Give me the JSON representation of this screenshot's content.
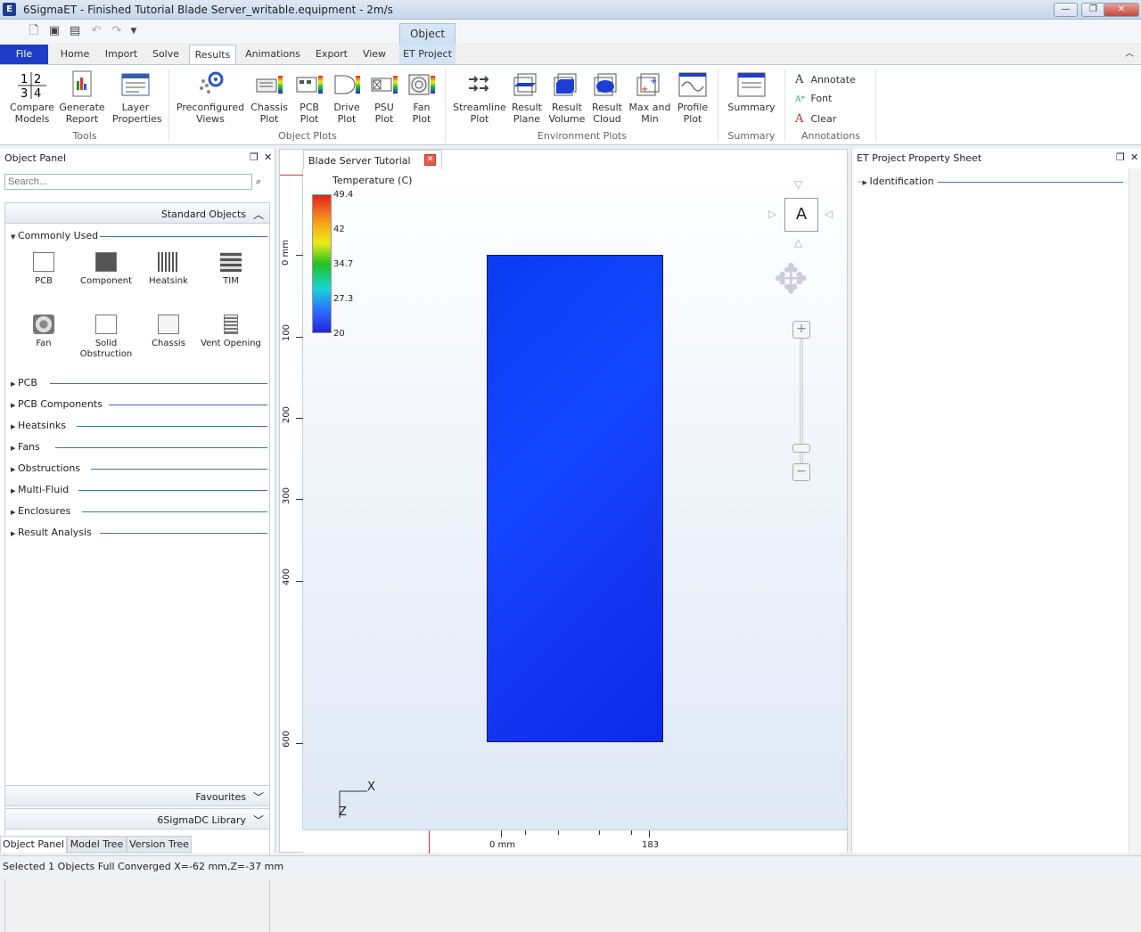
{
  "window": {
    "title": "6SigmaET - Finished Tutorial Blade Server_writable.equipment - 2m/s",
    "app_icon": "6sigma-app-icon"
  },
  "context_group": {
    "label": "Object"
  },
  "tabs": {
    "file": "File",
    "home": "Home",
    "import": "Import",
    "solve": "Solve",
    "results": "Results",
    "animations": "Animations",
    "export": "Export",
    "view": "View",
    "et_project": "ET Project"
  },
  "ribbon": {
    "tools": {
      "compare_models": "Compare\nModels",
      "generate_report": "Generate\nReport",
      "layer_properties": "Layer\nProperties",
      "group": "Tools"
    },
    "object_plots": {
      "preconfigured_views": "Preconfigured\nViews",
      "chassis_plot": "Chassis\nPlot",
      "pcb_plot": "PCB\nPlot",
      "drive_plot": "Drive\nPlot",
      "psu_plot": "PSU\nPlot",
      "fan_plot": "Fan\nPlot",
      "group": "Object Plots"
    },
    "environment_plots": {
      "streamline_plot": "Streamline\nPlot",
      "result_plane": "Result\nPlane",
      "result_volume": "Result\nVolume",
      "result_cloud": "Result\nCloud",
      "max_and_min": "Max and\nMin",
      "profile_plot": "Profile\nPlot",
      "group": "Environment Plots"
    },
    "summary": {
      "summary": "Summary",
      "group": "Summary"
    },
    "annotations": {
      "annotate": "Annotate",
      "font": "Font",
      "clear": "Clear",
      "group": "Annotations"
    }
  },
  "object_panel": {
    "title": "Object Panel",
    "search_placeholder": "Search...",
    "standard_objects": "Standard Objects",
    "commonly_used": "Commonly Used",
    "objects": [
      {
        "label": "PCB"
      },
      {
        "label": "Component"
      },
      {
        "label": "Heatsink"
      },
      {
        "label": "TIM"
      },
      {
        "label": "Fan"
      },
      {
        "label": "Solid\nObstruction"
      },
      {
        "label": "Chassis"
      },
      {
        "label": "Vent Opening"
      }
    ],
    "categories": [
      "PCB",
      "PCB Components",
      "Heatsinks",
      "Fans",
      "Obstructions",
      "Multi-Fluid",
      "Enclosures",
      "Result Analysis"
    ],
    "favourites": "Favourites",
    "library": "6SigmaDC Library",
    "bottom_tabs": [
      "Object Panel",
      "Model Tree",
      "Version Tree"
    ]
  },
  "viewport": {
    "doc_tab": "Blade Server Tutorial",
    "legend": {
      "title": "Temperature (C)",
      "ticks": [
        "49.4",
        "42",
        "34.7",
        "27.3",
        "20"
      ]
    },
    "nav_label": "A",
    "vruler_labels": [
      "0 mm",
      "100",
      "200",
      "300",
      "400",
      "600"
    ],
    "hruler_labels": [
      "0 mm",
      "183"
    ],
    "axis_x": "X",
    "axis_z": "Z"
  },
  "property_sheet": {
    "title": "ET Project Property Sheet",
    "section": "Identification"
  },
  "status": {
    "text": "Selected 1 Objects  Full Converged  X=-62 mm,Z=-37 mm"
  }
}
